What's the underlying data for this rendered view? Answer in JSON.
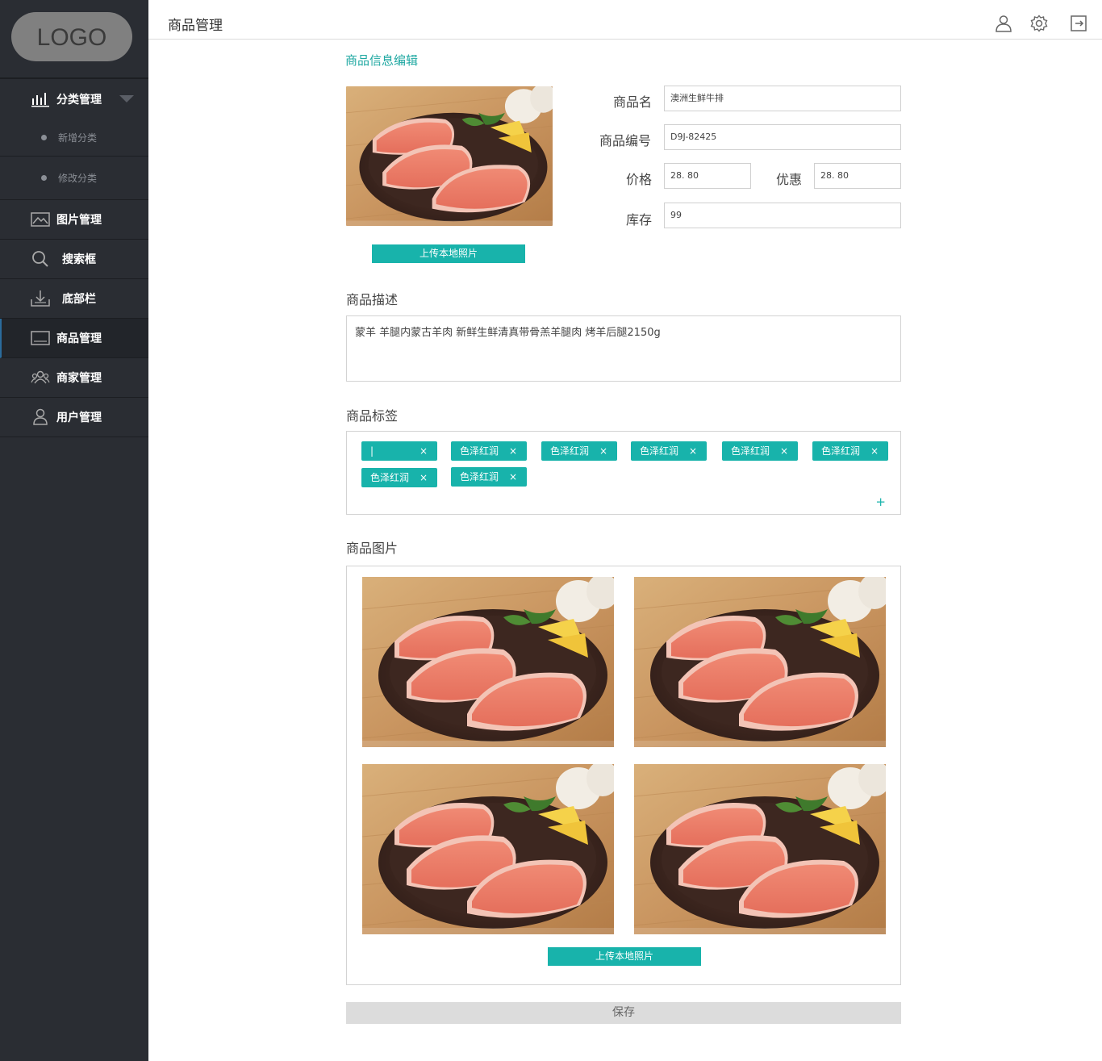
{
  "sidebar": {
    "logo": "LOGO",
    "category": {
      "label": "分类管理",
      "sub_items": [
        {
          "label": "新增分类"
        },
        {
          "label": "修改分类"
        }
      ]
    },
    "items": [
      {
        "label": "图片管理",
        "icon": "image-icon"
      },
      {
        "label": "搜索框",
        "icon": "search-icon"
      },
      {
        "label": "底部栏",
        "icon": "download-tray-icon"
      },
      {
        "label": "商品管理",
        "icon": "monitor-icon",
        "active": true
      },
      {
        "label": "商家管理",
        "icon": "users-group-icon"
      },
      {
        "label": "用户管理",
        "icon": "user-icon"
      }
    ]
  },
  "header": {
    "title": "商品管理",
    "icons": [
      "user-icon",
      "gear-icon",
      "logout-icon"
    ]
  },
  "editor": {
    "title": "商品信息编辑",
    "upload_label": "上传本地照片",
    "fields": {
      "name_label": "商品名",
      "name_value": "澳洲生鲜牛排",
      "code_label": "商品编号",
      "code_value": "D9J-82425",
      "price_label": "价格",
      "price_value": "28. 80",
      "discount_label": "优惠",
      "discount_value": "28. 80",
      "stock_label": "库存",
      "stock_value": "99"
    },
    "description_label": "商品描述",
    "description_value": "蒙羊 羊腿内蒙古羊肉 新鲜生鲜清真带骨羔羊腿肉 烤羊后腿2150g",
    "tags_label": "商品标签",
    "tags": [
      "|",
      "色泽红润",
      "色泽红润",
      "色泽红润",
      "色泽红润",
      "色泽红润",
      "色泽红润",
      "色泽红润"
    ],
    "tag_remove": "×",
    "tag_add": "+",
    "pictures_label": "商品图片",
    "pictures_upload_label": "上传本地照片",
    "save_label": "保存"
  },
  "colors": {
    "sidebar_bg": "#2a2d33",
    "accent": "#18b3ab",
    "active_indicator": "#2b6c9c",
    "save_bg": "#dcdcdc"
  }
}
